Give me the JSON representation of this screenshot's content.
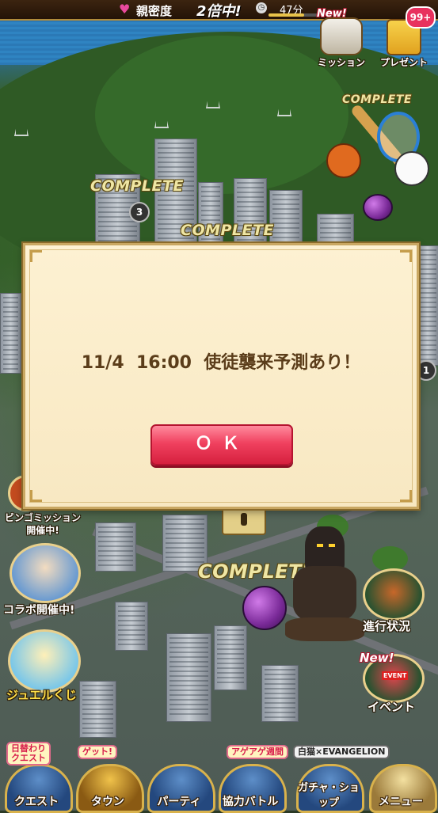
{
  "top_bar": {
    "heart_icon": "heart-icon",
    "bond_label": "親密度",
    "bond_bonus": "2倍中!",
    "timer_text": "47分",
    "timer_progress": 0.72
  },
  "right_buttons": {
    "mission": {
      "label": "ミッション",
      "new_tag": "New!"
    },
    "present": {
      "label": "プレゼント",
      "count": "99+"
    }
  },
  "map": {
    "complete_label": "COMPLETE",
    "stage_number_1": "3",
    "stage_number_2": "1",
    "sports_complete": "COMPLETE"
  },
  "left_buttons": {
    "bingo": "ビンゴミッション\n開催中!",
    "collab": "コラボ開催中!",
    "jewel": "ジュエルくじ"
  },
  "right_side_buttons": {
    "progress": "進行状況",
    "event": {
      "label": "イベント",
      "new_tag": "New!",
      "inner": "EVENT"
    }
  },
  "dialog": {
    "message": "11/4  16:00  使徒襲来予測あり！",
    "ok_label": "ＯＫ"
  },
  "bottom_nav": [
    {
      "label": "クエスト",
      "tag": "日替わり\nクエスト"
    },
    {
      "label": "タウン",
      "tag": "ゲット!"
    },
    {
      "label": "パーティ",
      "tag": ""
    },
    {
      "label": "協力バトル",
      "tag": "アゲアゲ週間"
    },
    {
      "label": "ガチャ・ショップ",
      "tag": "白猫×EVANGELION"
    },
    {
      "label": "メニュー",
      "tag": ""
    }
  ]
}
